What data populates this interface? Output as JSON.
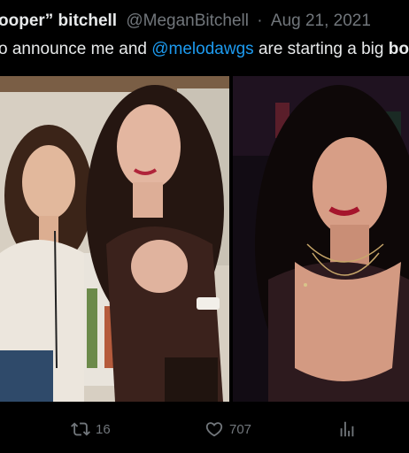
{
  "tweet": {
    "display_name": "ooper” bitchell",
    "handle": "@MeganBitchell",
    "separator": "·",
    "date": "Aug 21, 2021",
    "text_prefix": "o announce me and",
    "mention": "@melodawgs",
    "text_middle": "are starting a big",
    "text_bold": "bo"
  },
  "actions": {
    "retweet_icon": "retweet-icon",
    "retweet_count": "16",
    "like_icon": "heart-icon",
    "like_count": "707",
    "analytics_icon": "analytics-icon"
  },
  "colors": {
    "background": "#000000",
    "text": "#e7e9ea",
    "muted": "#71767b",
    "link": "#1d9bf0"
  }
}
